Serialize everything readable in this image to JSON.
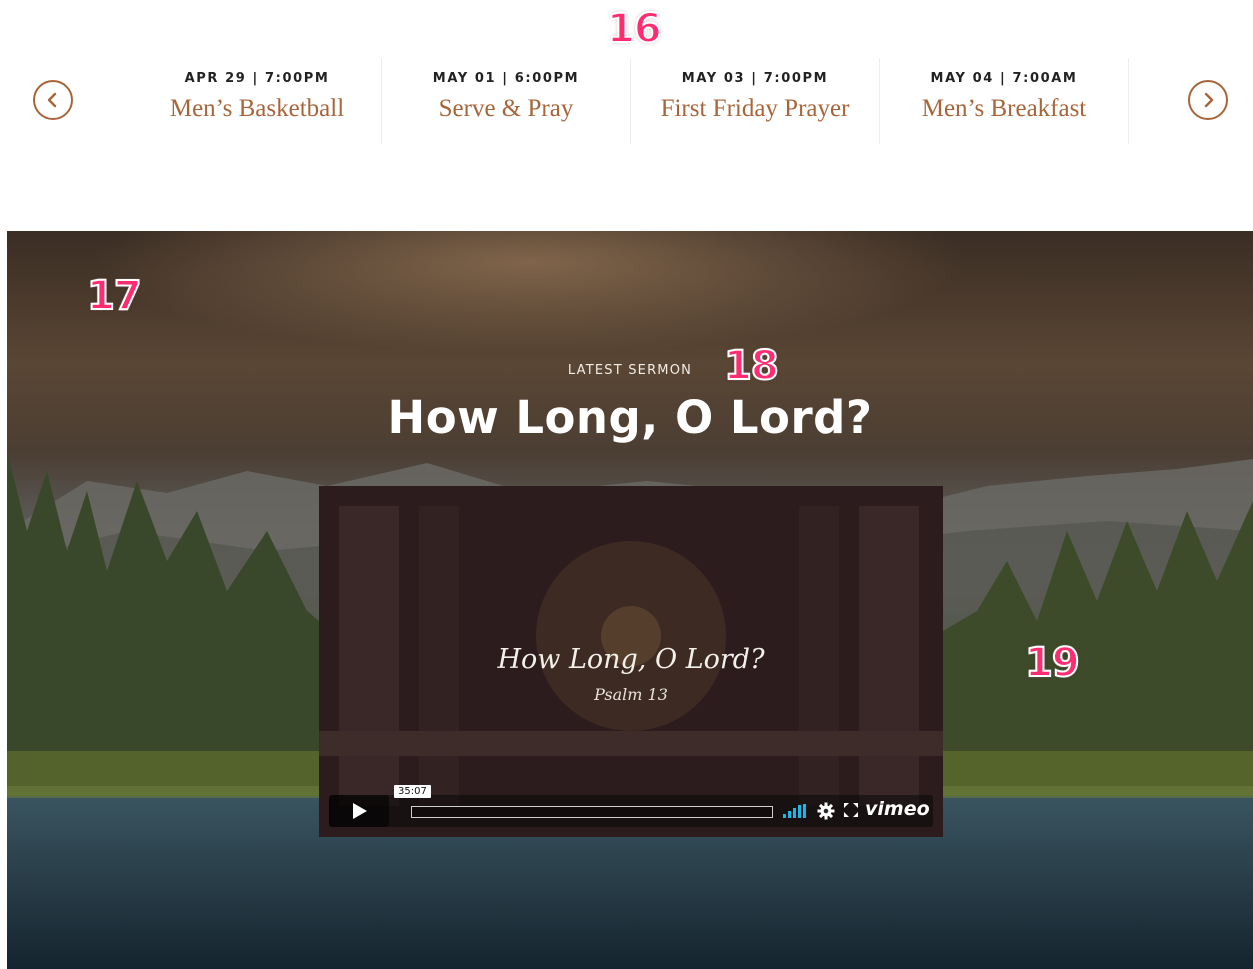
{
  "markers": {
    "m16": "16",
    "m17": "17",
    "m18": "18",
    "m19": "19"
  },
  "events": {
    "prev_icon": "chevron-left-icon",
    "next_icon": "chevron-right-icon",
    "items": [
      {
        "date": "APR 29  |  7:00PM",
        "name": "Men’s Basketball"
      },
      {
        "date": "MAY 01  |  6:00PM",
        "name": "Serve & Pray"
      },
      {
        "date": "MAY 03  |  7:00PM",
        "name": "First Friday Prayer"
      },
      {
        "date": "MAY 04  |  7:00AM",
        "name": "Men’s Breakfast"
      }
    ]
  },
  "sermon": {
    "label": "LATEST SERMON",
    "title": "How Long, O Lord?"
  },
  "video": {
    "title": "How Long, O Lord?",
    "subtitle": "Psalm 13",
    "timecode": "35:07",
    "brand": "vimeo",
    "progress": 0
  },
  "colors": {
    "accent": "#a8653a",
    "marker": "#ff2d6f",
    "date_text": "#222222"
  }
}
